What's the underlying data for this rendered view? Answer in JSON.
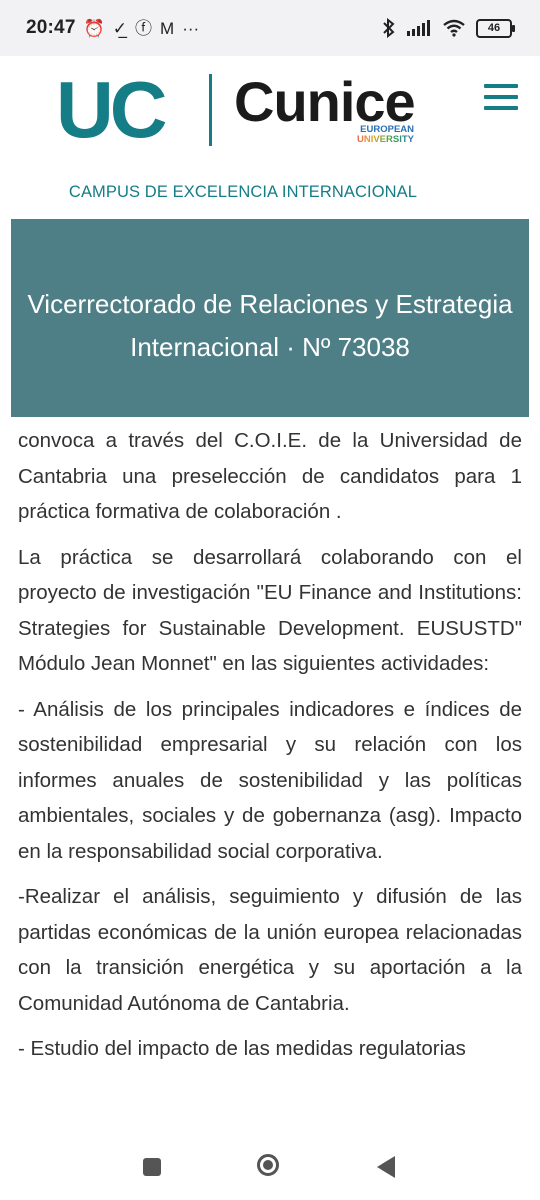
{
  "status_bar": {
    "time": "20:47",
    "left_icons": [
      "alarm-icon",
      "check-download-icon",
      "facebook-icon",
      "gmail-icon",
      "more-dots-icon"
    ],
    "right_icons": [
      "bluetooth-icon",
      "signal-icon",
      "wifi-icon"
    ],
    "battery": "46"
  },
  "header": {
    "logo_uc": "UC",
    "logo_eunice": "Cunice",
    "logo_eu_line1": "EUROPEAN",
    "logo_eu_line2": "UNIVERSITY",
    "campus": "CAMPUS DE EXCELENCIA INTERNACIONAL",
    "colors": {
      "brand": "#147d86",
      "banner": "#4e7f87"
    }
  },
  "banner": {
    "line1": "Vicerrectorado de Relaciones y Estrategia",
    "line2": "Internacional · Nº 73038"
  },
  "content": {
    "p1": "convoca a través del C.O.I.E. de la Universidad de Cantabria una preselección de candidatos para 1 práctica formativa de colaboración .",
    "p2": "La práctica se desarrollará colaborando con el proyecto de investigación \"EU Finance and Institutions: Strategies for Sustainable Development. EUSUSTD\" Módulo Jean Monnet\" en las siguientes actividades:",
    "p3": "- Análisis de los principales indicadores e índices de sostenibilidad empresarial y su relación con los informes anuales de sostenibilidad y las políticas ambientales, sociales y de gobernanza (asg). Impacto en la responsabilidad social corporativa.",
    "p4": "-Realizar el análisis, seguimiento y difusión de las partidas económicas de la unión europea relacionadas con la transición energética y su aportación a la Comunidad Autónoma de Cantabria.",
    "p5": "- Estudio del impacto de las medidas regulatorias"
  },
  "nav_bar": {
    "buttons": [
      "recents-square-icon",
      "home-circle-icon",
      "back-triangle-icon"
    ]
  }
}
